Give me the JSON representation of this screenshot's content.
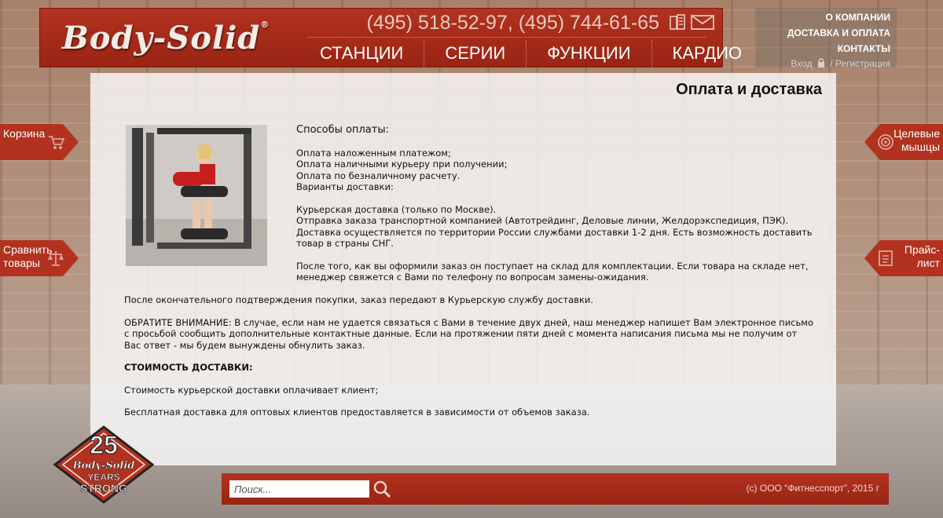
{
  "header": {
    "logo": "Body-Solid",
    "logo_mark": "®",
    "phones": "(495) 518-52-97, (495) 744-61-65",
    "nav": [
      "СТАНЦИИ",
      "СЕРИИ",
      "ФУНКЦИИ",
      "КАРДИО"
    ]
  },
  "info_panel": {
    "links": [
      "О КОМПАНИИ",
      "ДОСТАВКА И ОПЛАТА",
      "КОНТАКТЫ"
    ],
    "login": "Вход",
    "separator": "/",
    "register": "Регистрация"
  },
  "side_tabs": {
    "cart": "Корзина",
    "compare_line1": "Сравнить",
    "compare_line2": "товары",
    "muscles_line1": "Целевые",
    "muscles_line2": "мышцы",
    "price_line1": "Прайс-",
    "price_line2": "лист"
  },
  "content": {
    "title": "Оплата и доставка",
    "payment_heading": "Способы оплаты:",
    "payment_lines": [
      "Оплата наложенным платежом;",
      "Оплата наличными курьеру при получении;",
      "Оплата по безналичному расчету.",
      "Варианты доставки:"
    ],
    "delivery_lines": [
      "Курьерская доставка (только по Москве).",
      "Отправка заказа транспортной компанией (Автотрейдинг, Деловые линии, Желдорэкспедиция, ПЭК).",
      "Доставка осуществляется по территории России службами доставки 1-2 дня. Есть возможность доставить товар в страны СНГ."
    ],
    "order_note": "После того, как вы оформили заказ он поступает на склад для комплектации. Если товара на складе нет, менеджер свяжется с Вами по телефону по вопросам замены-ожидания.",
    "confirm_note": "После окончательного подтверждения покупки, заказ передают в Курьерскую службу доставки.",
    "attention": "ОБРАТИТЕ ВНИМАНИЕ: В случае, если нам не удается связаться с Вами в течение двух дней, наш менеджер напишет Вам электронное письмо с просьбой сообщить дополнительные контактные данные. Если на протяжении пяти дней с момента написания письма мы не получим от Вас ответ - мы будем вынуждены обнулить заказ.",
    "cost_heading": "СТОИМОСТЬ ДОСТАВКИ:",
    "cost_client": "Стоимость курьерской доставки оплачивает клиент;",
    "cost_wholesale": "Бесплатная доставка для оптовых клиентов предоставляется в зависимости от объемов заказа."
  },
  "badge": {
    "number": "25",
    "brand": "Body-Solid",
    "line1": "YEARS",
    "line2": "STRONG"
  },
  "footer": {
    "search_placeholder": "Поиск...",
    "copyright": "(c) ООО “Фитнесспорт”, 2015 г"
  },
  "colors": {
    "brand_red": "#b2321f",
    "text_dark": "#111111"
  }
}
